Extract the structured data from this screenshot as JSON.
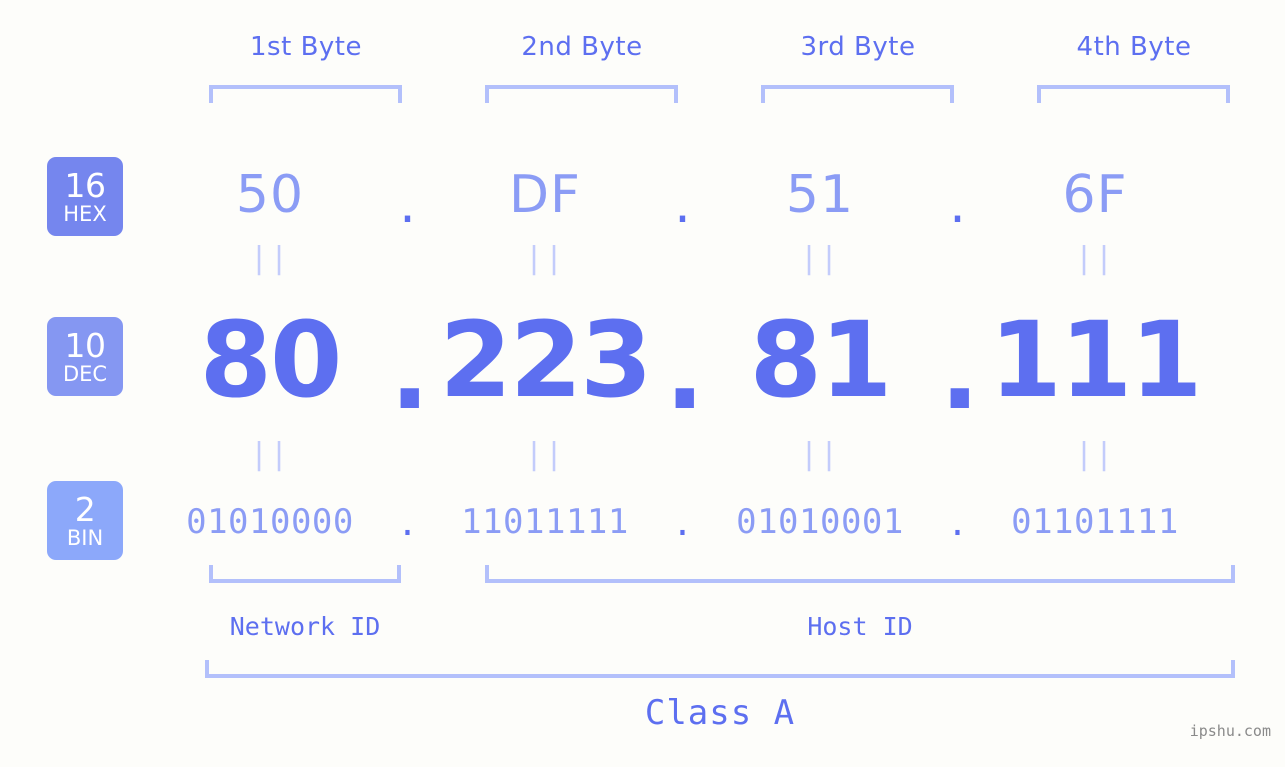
{
  "page": {
    "background_color": "#fdfdfa",
    "accent_color": "#5d6ff0",
    "accent_light_color": "#8b9cf5",
    "bracket_color": "#b3c0fb"
  },
  "byte_headers": [
    {
      "label": "1st Byte"
    },
    {
      "label": "2nd Byte"
    },
    {
      "label": "3rd Byte"
    },
    {
      "label": "4th Byte"
    }
  ],
  "bases": [
    {
      "number": "16",
      "name": "HEX",
      "color": "#7586ee"
    },
    {
      "number": "10",
      "name": "DEC",
      "color": "#8597f2"
    },
    {
      "number": "2",
      "name": "BIN",
      "color": "#8ca8fa"
    }
  ],
  "rows": {
    "hex": {
      "base": "16",
      "values": [
        "50",
        "DF",
        "51",
        "6F"
      ],
      "separator": "."
    },
    "dec": {
      "base": "10",
      "values": [
        "80",
        "223",
        "81",
        "111"
      ],
      "separator": "."
    },
    "bin": {
      "base": "2",
      "values": [
        "01010000",
        "11011111",
        "01010001",
        "01101111"
      ],
      "separator": "."
    }
  },
  "equality": {
    "symbol": "||"
  },
  "segments": [
    {
      "label": "Network ID"
    },
    {
      "label": "Host ID"
    }
  ],
  "class": {
    "label": "Class A"
  },
  "watermark": {
    "text": "ipshu.com"
  }
}
